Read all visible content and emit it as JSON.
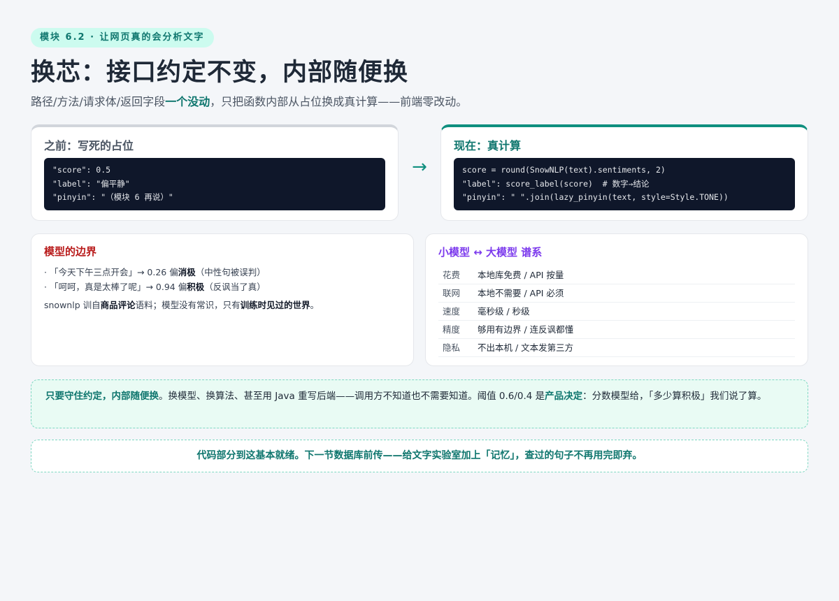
{
  "header": {
    "badge": "模块 6.2 · 让网页真的会分析文字",
    "title": "换芯：接口约定不变，内部随便换",
    "subtitle_pre": "路径/方法/请求体/返回字段",
    "subtitle_strong": "一个没动",
    "subtitle_post": "，只把函数内部从占位换成真计算——前端零改动。"
  },
  "before": {
    "heading": "之前：写死的占位",
    "code": [
      "\"score\": 0.5",
      "\"label\": \"偏平静\"",
      "\"pinyin\": \"（模块 6 再说）\""
    ]
  },
  "arrow": "→",
  "after": {
    "heading": "现在：真计算",
    "code": [
      "score = round(SnowNLP(text).sentiments, 2)",
      "\"label\": score_label(score)  # 数字→结论",
      "\"pinyin\": \" \".join(lazy_pinyin(text, style=Style.TONE))"
    ]
  },
  "limits": {
    "heading": "模型的边界",
    "items": [
      {
        "pre": "· 「今天下午三点开会」→ 0.26 偏",
        "bold": "消极",
        "post": "（中性句被误判）"
      },
      {
        "pre": "· 「呵呵，真是太棒了呢」→ 0.94 偏",
        "bold": "积极",
        "post": "（反讽当了真）"
      }
    ],
    "note_pre": "snownlp 训自",
    "note_bold1": "商品评论",
    "note_mid": "语料；模型没有常识，只有",
    "note_bold2": "训练时见过的世界",
    "note_post": "。"
  },
  "compare": {
    "heading": "小模型 ↔ 大模型 谱系",
    "rows": [
      {
        "key": "花费",
        "value": "本地库免费 / API 按量"
      },
      {
        "key": "联网",
        "value": "本地不需要 / API 必须"
      },
      {
        "key": "速度",
        "value": "毫秒级 / 秒级"
      },
      {
        "key": "精度",
        "value": "够用有边界 / 连反讽都懂"
      },
      {
        "key": "隐私",
        "value": "不出本机 / 文本发第三方"
      }
    ]
  },
  "note": {
    "bold1": "只要守住约定，内部随便换",
    "text1": "。换模型、换算法、甚至用 Java 重写后端——调用方不知道也不需要知道。阈值 0.6/0.4 是",
    "bold2": "产品决定",
    "text2": "：分数模型给，「多少算积极」我们说了算。"
  },
  "footer": "代码部分到这基本就绪。下一节数据库前传——给文字实验室加上「记忆」，查过的句子不再用完即弃。"
}
